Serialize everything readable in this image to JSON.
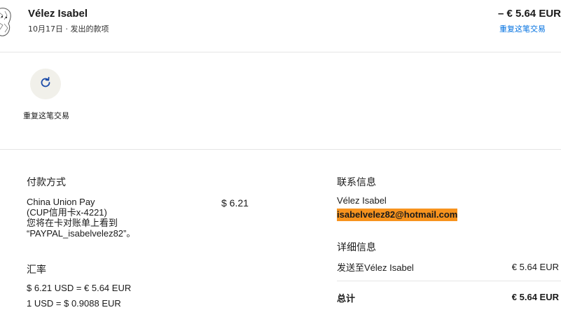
{
  "header": {
    "name": "Vélez Isabel",
    "subtitle": "10月17日 · 发出的款项",
    "amount": "– € 5.64 EUR",
    "repeat_link": "重复这笔交易"
  },
  "action": {
    "repeat_label": "重复这笔交易"
  },
  "payment_method": {
    "title": "付款方式",
    "line1": "China Union Pay",
    "line2": "(CUP信用卡x-4221)",
    "line3": "您将在卡对账单上看到",
    "line4": "“PAYPAL_isabelvelez82”。",
    "amount": "$ 6.21"
  },
  "exchange_rate": {
    "title": "汇率",
    "line1": "$ 6.21 USD = € 5.64 EUR",
    "line2": "1 USD = $ 0.9088 EUR"
  },
  "contact": {
    "title": "联系信息",
    "name": "Vélez Isabel",
    "email": "isabelvelez82@hotmail.com"
  },
  "details": {
    "title": "详细信息",
    "sent_to_label": "发送至Vélez Isabel",
    "sent_to_value": "€ 5.64 EUR",
    "total_label": "总计",
    "total_value": "€ 5.64 EUR"
  },
  "colors": {
    "link": "#0070e0",
    "email_highlight": "#f7931e",
    "repeat_icon": "#1a4aa8"
  }
}
